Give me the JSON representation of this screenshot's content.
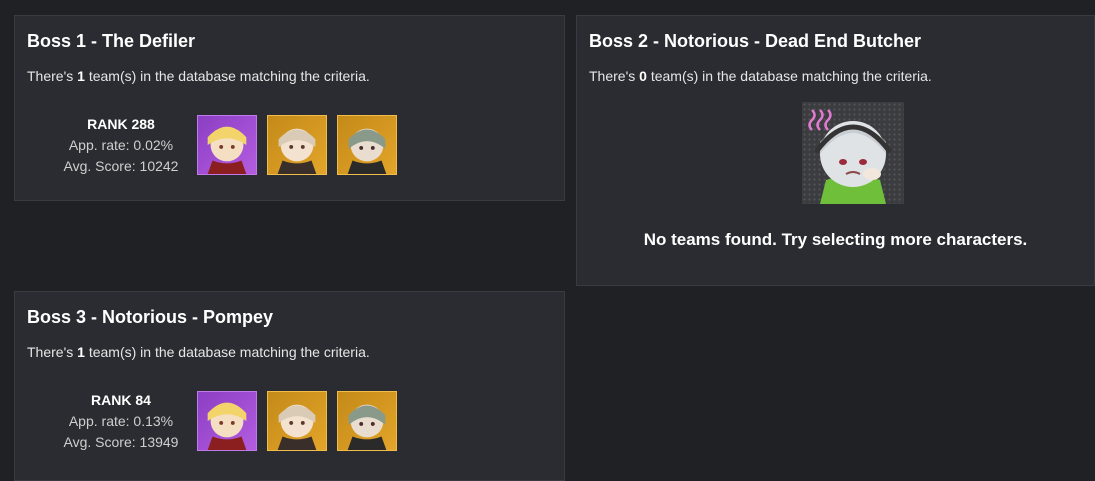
{
  "boss1": {
    "title": "Boss 1 - The Defiler",
    "desc_prefix": "There's ",
    "count": "1",
    "desc_suffix": " team(s) in the database matching the criteria.",
    "rank": "RANK 288",
    "app_rate": "App. rate: 0.02%",
    "avg_score": "Avg. Score: 10242"
  },
  "boss2": {
    "title": "Boss 2 - Notorious - Dead End Butcher",
    "desc_prefix": "There's ",
    "count": "0",
    "desc_suffix": " team(s) in the database matching the criteria.",
    "empty_message": "No teams found. Try selecting more characters."
  },
  "boss3": {
    "title": "Boss 3 - Notorious - Pompey",
    "desc_prefix": "There's ",
    "count": "1",
    "desc_suffix": " team(s) in the database matching the criteria.",
    "rank": "RANK 84",
    "app_rate": "App. rate: 0.13%",
    "avg_score": "Avg. Score: 13949"
  },
  "colors": {
    "background": "#202125",
    "card": "#2b2c31",
    "rarity_s": "#b45ce0",
    "rarity_a": "#e3a52a"
  },
  "icons": [
    "character-portrait-blonde",
    "character-portrait-silver",
    "character-portrait-green",
    "sad-chibi-illustration"
  ]
}
